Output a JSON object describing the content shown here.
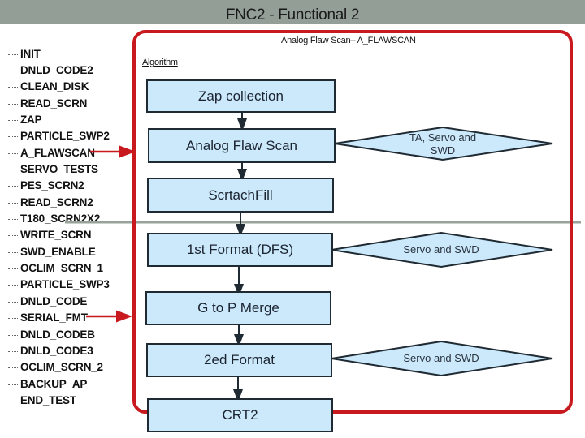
{
  "header": {
    "title": "FNC2 - Functional 2"
  },
  "test_list": {
    "items": [
      {
        "label": "INIT"
      },
      {
        "label": "DNLD_CODE2"
      },
      {
        "label": "CLEAN_DISK"
      },
      {
        "label": "READ_SCRN"
      },
      {
        "label": "ZAP"
      },
      {
        "label": "PARTICLE_SWP2"
      },
      {
        "label": "A_FLAWSCAN",
        "arrow": true
      },
      {
        "label": "SERVO_TESTS"
      },
      {
        "label": "PES_SCRN2"
      },
      {
        "label": "READ_SCRN2"
      },
      {
        "label": "T180_SCRN2X2"
      },
      {
        "label": "WRITE_SCRN"
      },
      {
        "label": "SWD_ENABLE"
      },
      {
        "label": "OCLIM_SCRN_1"
      },
      {
        "label": "PARTICLE_SWP3"
      },
      {
        "label": "DNLD_CODE"
      },
      {
        "label": "SERIAL_FMT",
        "arrow": true
      },
      {
        "label": "DNLD_CODEB"
      },
      {
        "label": "DNLD_CODE3"
      },
      {
        "label": "OCLIM_SCRN_2"
      },
      {
        "label": "BACKUP_AP"
      },
      {
        "label": "END_TEST"
      }
    ]
  },
  "diagram": {
    "frame_title": "Analog Flaw Scan– A_FLAWSCAN",
    "algorithm_label": "Algorithm",
    "steps": [
      {
        "label": "Zap collection"
      },
      {
        "label": "Analog Flaw Scan"
      },
      {
        "label": "ScrtachFill"
      },
      {
        "label": "1st Format (DFS)"
      },
      {
        "label": "G to P Merge"
      },
      {
        "label": "2ed Format"
      },
      {
        "label": "CRT2"
      }
    ],
    "decisions": [
      {
        "label": "TA, Servo and SWD",
        "attached_to": "Analog Flaw Scan"
      },
      {
        "label": "Servo and SWD",
        "attached_to": "1st Format (DFS)"
      },
      {
        "label": "Servo and SWD",
        "attached_to": "2ed Format"
      }
    ]
  },
  "colors": {
    "title_bar": "#939f96",
    "frame_red": "#c8191f",
    "box_fill": "#cce9fb",
    "box_border": "#1f2a33",
    "divider_gray": "#97a39a"
  }
}
